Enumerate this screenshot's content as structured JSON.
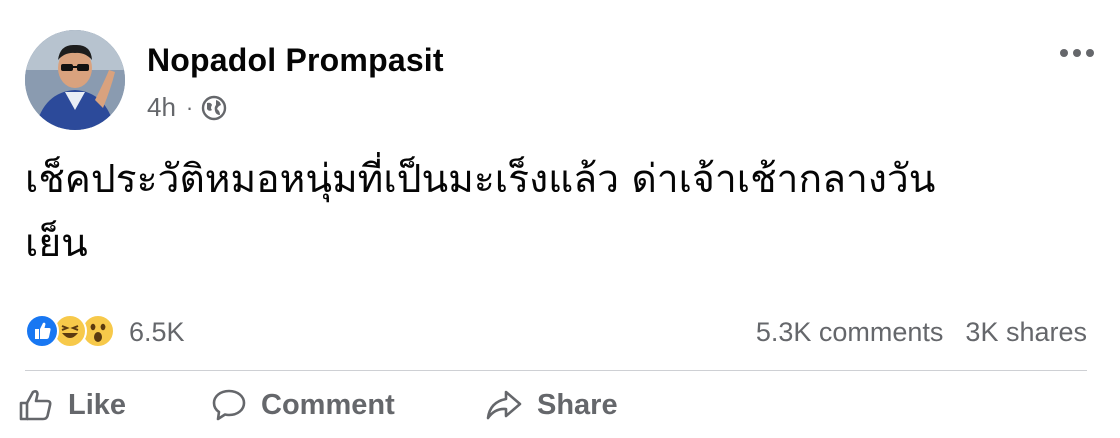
{
  "post": {
    "author": "Nopadol Prompasit",
    "time": "4h",
    "separator": "·",
    "privacy_icon": "globe-icon",
    "text_line1": "เช็คประวัติหมอหนุ่มที่เป็นมะเร็งแล้ว ด่าเจ้าเช้ากลางวัน",
    "text_line2": "เย็น"
  },
  "reactions": {
    "types": [
      "like",
      "haha",
      "wow"
    ],
    "count": "6.5K"
  },
  "stats": {
    "comments": "5.3K comments",
    "shares": "3K shares"
  },
  "actions": {
    "like_label": "Like",
    "comment_label": "Comment",
    "share_label": "Share"
  },
  "colors": {
    "name": "#050505",
    "secondary": "#65676b",
    "like_blue": "#1877f2",
    "emoji_yellow": "#f7c94a",
    "divider": "#ced0d4"
  }
}
